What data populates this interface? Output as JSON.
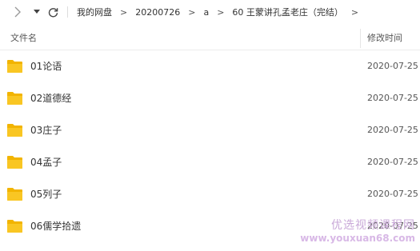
{
  "toolbar": {
    "forward_icon": "chevron-right-icon",
    "dropdown_icon": "caret-down-icon",
    "refresh_icon": "refresh-icon"
  },
  "breadcrumb": [
    "我的网盘",
    "20200726",
    "a",
    "60 王蒙讲孔孟老庄（完结）"
  ],
  "columns": {
    "name": "文件名",
    "modified": "修改时间"
  },
  "rows": [
    {
      "name": "01论语",
      "date": "2020-07-25"
    },
    {
      "name": "02道德经",
      "date": "2020-07-25"
    },
    {
      "name": "03庄子",
      "date": "2020-07-25"
    },
    {
      "name": "04孟子",
      "date": "2020-07-25"
    },
    {
      "name": "05列子",
      "date": "2020-07-25"
    },
    {
      "name": "06儒学拾遗",
      "date": "2020-07-25"
    }
  ],
  "watermark": {
    "cn": "优选视频课程网",
    "url": "www.youxuan68.com"
  },
  "colors": {
    "folder": "#F9C623",
    "folder_tab": "#F2B400"
  }
}
